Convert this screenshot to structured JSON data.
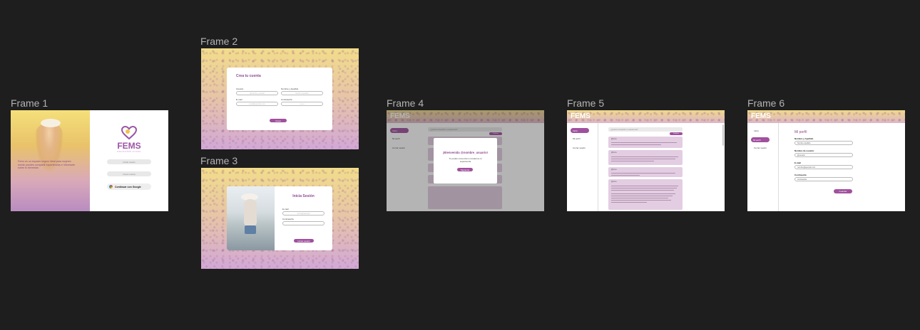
{
  "frames": {
    "f1": {
      "label": "Frame 1"
    },
    "f2": {
      "label": "Frame 2"
    },
    "f3": {
      "label": "Frame 3"
    },
    "f4": {
      "label": "Frame 4"
    },
    "f5": {
      "label": "Frame 5"
    },
    "f6": {
      "label": "Frame 6"
    }
  },
  "brand": {
    "name": "FEMS",
    "tagline": "ENCONTRÁ AYUDA"
  },
  "frame1": {
    "intro": "Fems es un espacio seguro ideal para mujeres donde puedes compartir experiencias e informarte sobre tu bienestar.",
    "login_btn": "Iniciar sesión",
    "register_btn": "Crear cuenta",
    "google_btn": "Continuar con Google"
  },
  "frame2": {
    "title": "Crea tu cuenta",
    "usuario_label": "Usuario",
    "usuario_ph": "@nombre_usuario",
    "nombre_label": "Nombre y Apellido",
    "nombre_ph": "Nombre Apellido",
    "email_label": "E-mail",
    "email_ph": "email@ejemplo.com",
    "password_label": "Contraseña",
    "password_ph": "••••••••",
    "submit": "Crear"
  },
  "frame3": {
    "title": "Inicia Sesión",
    "email_label": "E-mail",
    "email_ph": "ferme@ejemplo",
    "password_label": "Contraseña",
    "password_ph": "",
    "submit": "Iniciar sesión"
  },
  "frame4": {
    "nav_inicio": "Inicio",
    "nav_perfil": "Mi perfil",
    "nav_logout": "Cerrar sesión",
    "compose_ph": "¿Querés compartir tu experiencia?",
    "compose_btn": "Publicar",
    "modal_title": "¡Bienvenida @nombre_usuario!",
    "modal_body": "Tu podés comenzar a contarnos tu experiencia",
    "modal_btn": "Siguiente"
  },
  "frame5": {
    "nav_inicio": "Inicio",
    "nav_perfil": "Mi perfil",
    "nav_logout": "Cerrar sesión",
    "compose_ph": "¿Querés compartir tu experiencia?",
    "compose_btn": "Publicar",
    "post_user": "@fems",
    "post_user2": "Hace 1h"
  },
  "frame6": {
    "nav_inicio": "Inicio",
    "nav_perfil": "Mi perfil",
    "nav_logout": "Cerrar sesión",
    "title": "Mi perfil",
    "name_label": "Nombre y Apellido",
    "name_val": "Nombre Apellido",
    "user_label": "Nombre de usuario",
    "user_val": "@usuario",
    "email_label": "E-mail",
    "email_val": "nombre@ejemplo.com",
    "pass_label": "Contraseña",
    "pass_val": "Contraseña",
    "submit": "Guardar"
  },
  "colors": {
    "accent": "#a0509e",
    "canvas": "#1e1e1e",
    "label": "#b3b3b3"
  }
}
